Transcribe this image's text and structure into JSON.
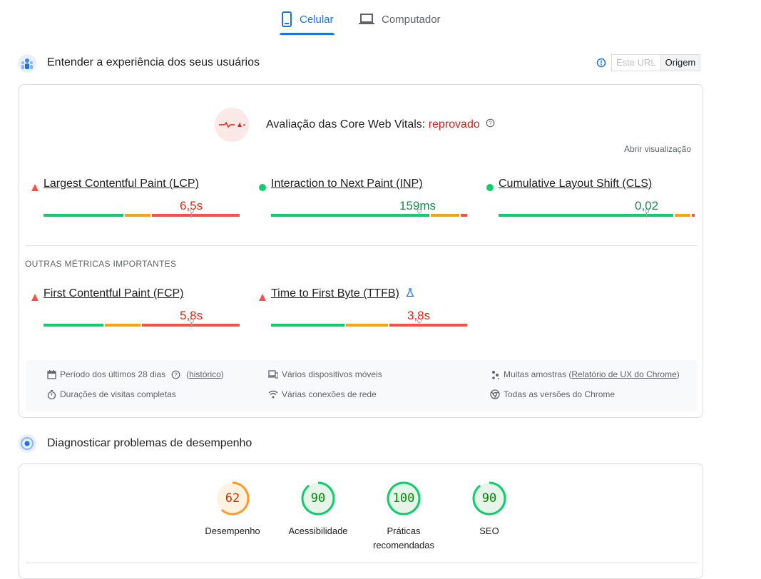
{
  "tabs": [
    {
      "label": "Celular",
      "icon": "phone-icon",
      "active": true
    },
    {
      "label": "Computador",
      "icon": "laptop-icon",
      "active": false
    }
  ],
  "field_section": {
    "title": "Entender a experiência dos seus usuários",
    "icon": "users-icon",
    "url_toggle": {
      "this_url": "Este URL",
      "origin": "Origem",
      "selected": "Origem"
    }
  },
  "cwv": {
    "label": "Avaliação das Core Web Vitals:",
    "status": "reprovado",
    "open_view": "Abrir visualização",
    "metrics": [
      {
        "name": "Largest Contentful Paint (LCP)",
        "value": "6,5s",
        "status": "poor",
        "pct_good": 0.41,
        "pct_ni": 0.14,
        "pct_poor": 0.45,
        "marker": 0.75
      },
      {
        "name": "Interaction to Next Paint (INP)",
        "value": "159ms",
        "status": "good",
        "pct_good": 0.81,
        "pct_ni": 0.15,
        "pct_poor": 0.04,
        "marker": 0.75
      },
      {
        "name": "Cumulative Layout Shift (CLS)",
        "value": "0,02",
        "status": "good",
        "pct_good": 0.89,
        "pct_ni": 0.09,
        "pct_poor": 0.02,
        "marker": 0.75
      }
    ]
  },
  "other": {
    "heading": "OUTRAS MÉTRICAS IMPORTANTES",
    "metrics": [
      {
        "name": "First Contentful Paint (FCP)",
        "value": "5,8s",
        "status": "poor",
        "pct_good": 0.31,
        "pct_ni": 0.19,
        "pct_poor": 0.5,
        "marker": 0.75,
        "lab_icon": false
      },
      {
        "name": "Time to First Byte (TTFB)",
        "value": "3,8s",
        "status": "poor",
        "pct_good": 0.38,
        "pct_ni": 0.22,
        "pct_poor": 0.4,
        "marker": 0.75,
        "lab_icon": true
      }
    ]
  },
  "info": {
    "period": "Período dos últimos 28 dias",
    "history": "histórico",
    "devices": "Vários dispositivos móveis",
    "samples_prefix": "Muitas amostras",
    "samples_link": "Relatório de UX do Chrome",
    "durations": "Durações de visitas completas",
    "network": "Várias conexões de rede",
    "versions": "Todas as versões do Chrome"
  },
  "diag_section": {
    "title": "Diagnosticar problemas de desempenho",
    "icon": "lighthouse-icon"
  },
  "scores": [
    {
      "label": "Desempenho",
      "label2": "",
      "value": "62",
      "score": 62,
      "color": "#fa9c2a",
      "text_color": "#c33300",
      "bg": "#fff3e0"
    },
    {
      "label": "Acessibilidade",
      "label2": "",
      "value": "90",
      "score": 90,
      "color": "#0cce6b",
      "text_color": "#008800",
      "bg": "#e6f4ea"
    },
    {
      "label": "Práticas",
      "label2": "recomendadas",
      "value": "100",
      "score": 100,
      "color": "#0cce6b",
      "text_color": "#008800",
      "bg": "#e6f4ea"
    },
    {
      "label": "SEO",
      "label2": "",
      "value": "90",
      "score": 90,
      "color": "#0cce6b",
      "text_color": "#008800",
      "bg": "#e6f4ea"
    }
  ],
  "colors": {
    "good": "#0cce6b",
    "ni": "#ffa400",
    "poor": "#ff4e42",
    "accent": "#1a73e8"
  }
}
